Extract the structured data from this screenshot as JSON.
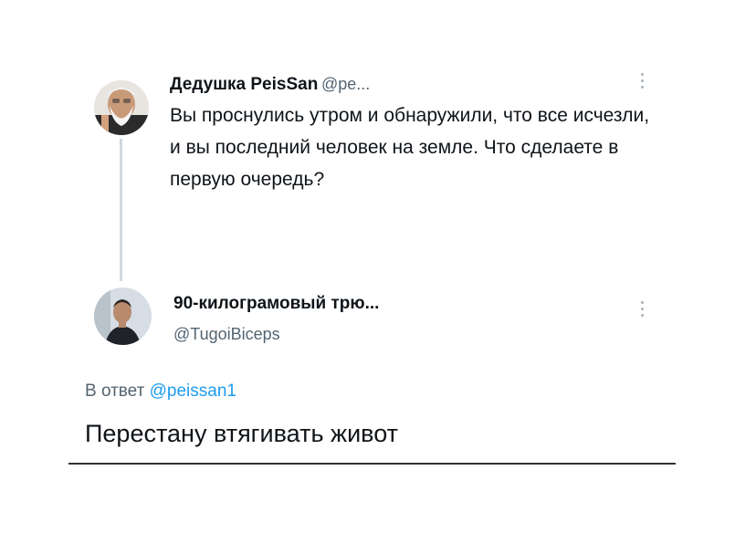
{
  "tweet": {
    "author_name": "Дедушка PeisSan",
    "author_handle": "@pe...",
    "text": "Вы проснулись утром и обнаружили, что все исчезли, и вы последний человек на земле. Что сделаете в первую очередь?"
  },
  "reply": {
    "author_name": "90-килограмовый трю...",
    "author_handle": "@TugoiBiceps",
    "reply_prefix": "В ответ",
    "reply_mention": "@peissan1",
    "text": "Перестану втягивать живот"
  },
  "colors": {
    "text": "#0f1419",
    "secondary": "#536471",
    "link": "#1d9bf0",
    "thread_line": "#cfd9de"
  },
  "icons": {
    "more": "more-vertical-icon"
  }
}
